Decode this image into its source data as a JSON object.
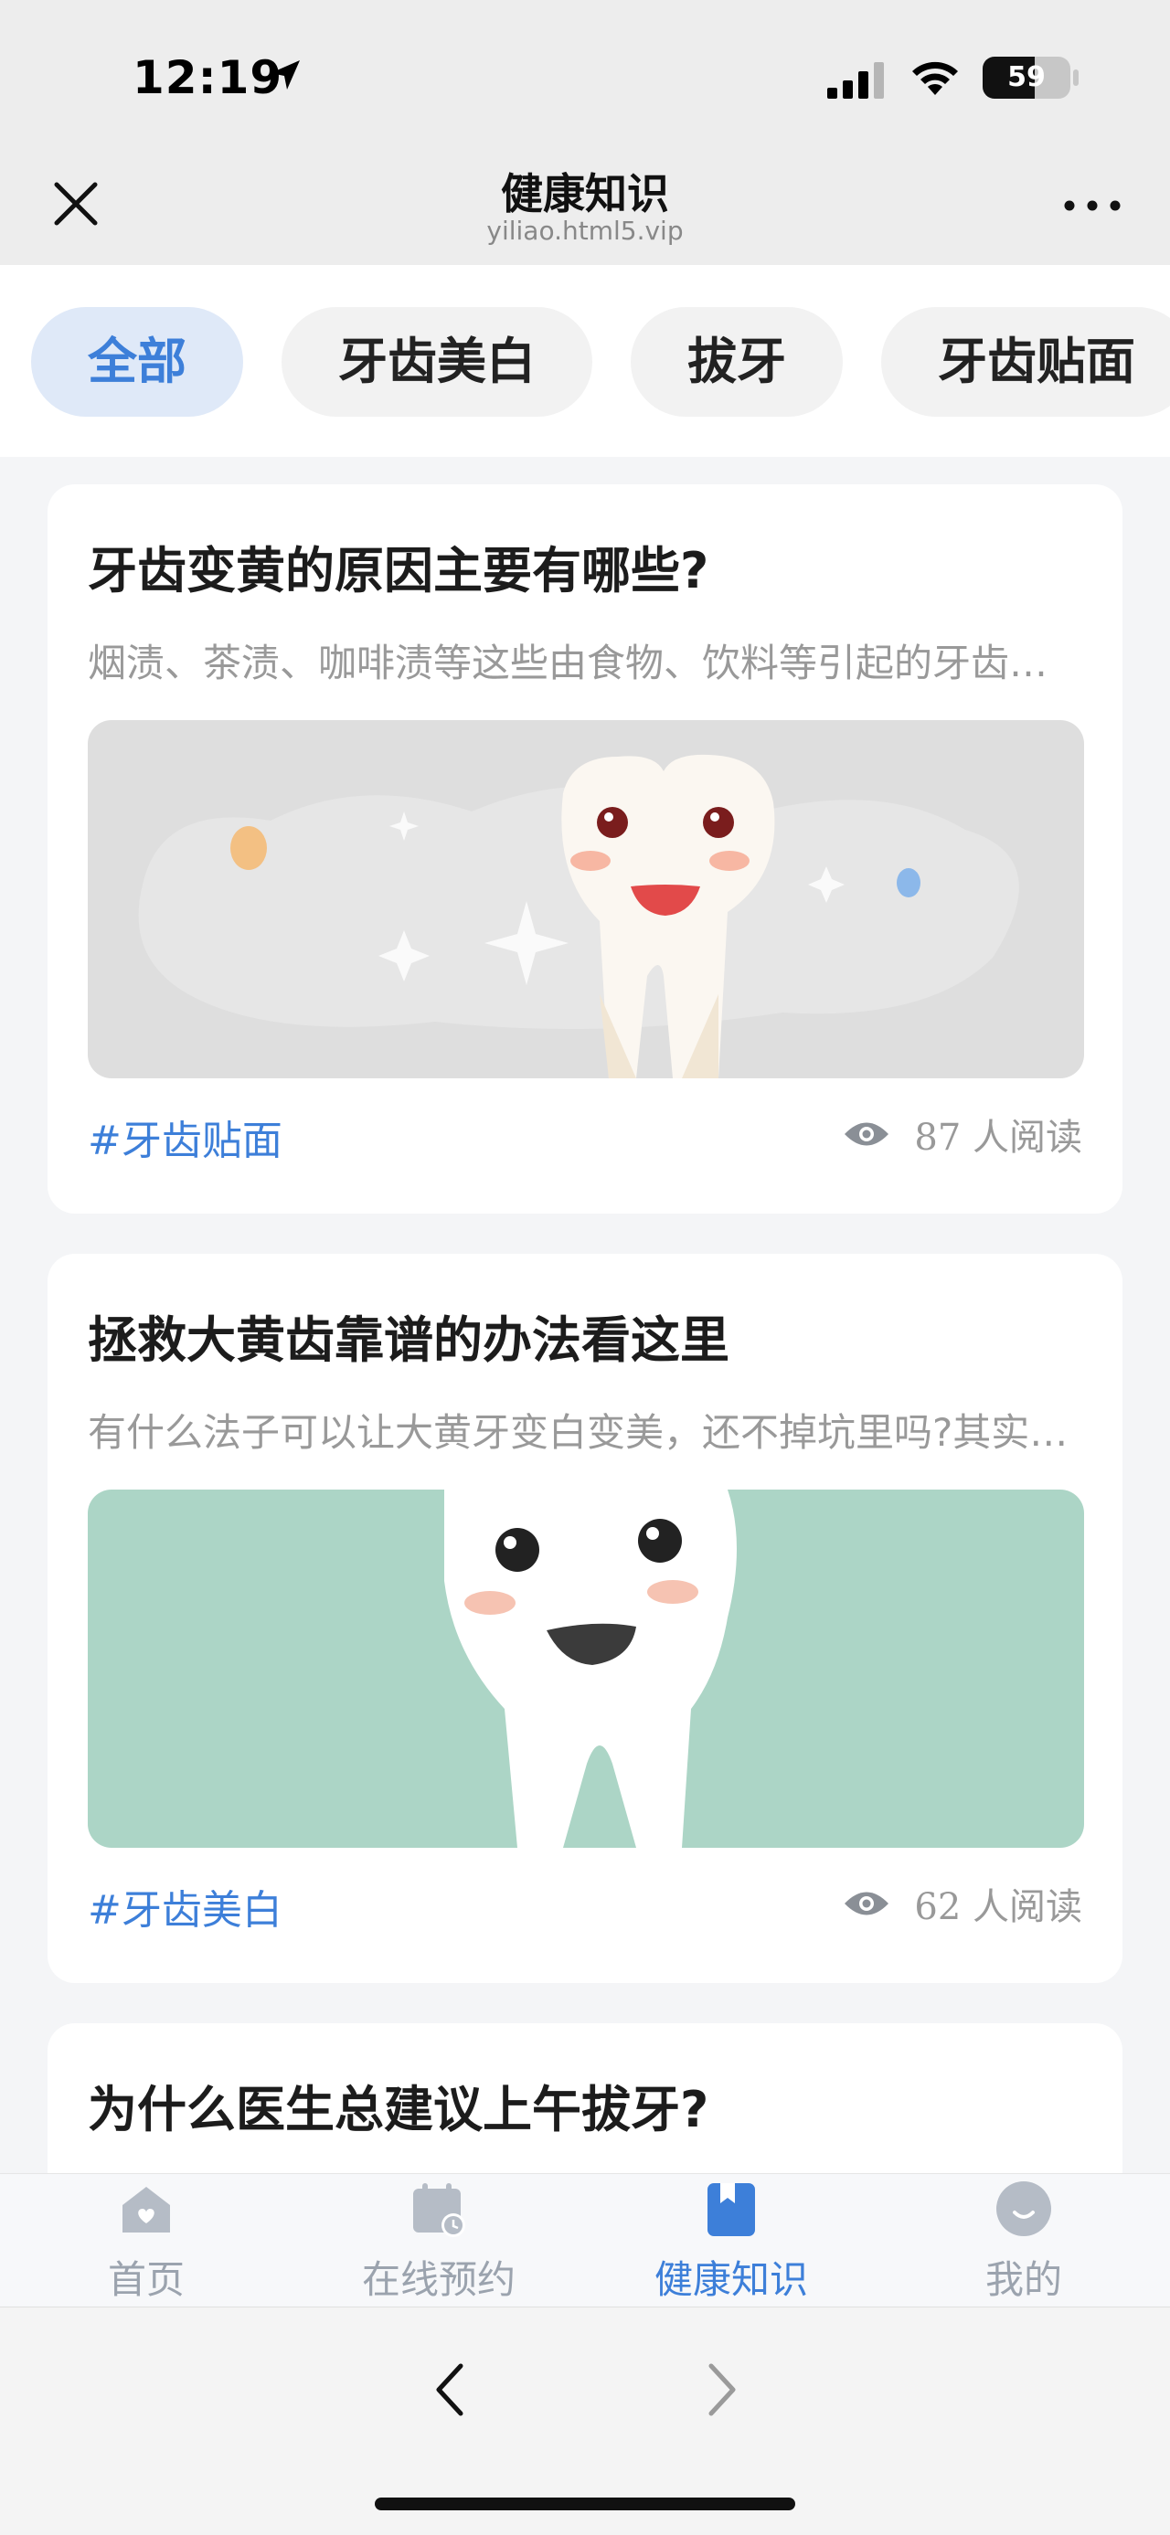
{
  "status_bar": {
    "time": "12:19",
    "battery": "59",
    "battery_level": 0.59
  },
  "header": {
    "title": "健康知识",
    "url": "yiliao.html5.vip"
  },
  "categories": [
    {
      "label": "全部",
      "active": true
    },
    {
      "label": "牙齿美白",
      "active": false
    },
    {
      "label": "拔牙",
      "active": false
    },
    {
      "label": "牙齿贴面",
      "active": false
    }
  ],
  "articles": [
    {
      "title": "牙齿变黄的原因主要有哪些?",
      "excerpt": "烟渍、茶渍、咖啡渍等这些由食物、饮料等引起的牙齿表面着色",
      "tag": "#牙齿贴面",
      "views": "87 人阅读",
      "image": {
        "bg": "#dedede",
        "icon": "tooth-illustration"
      }
    },
    {
      "title": "拯救大黄齿靠谱的办法看这里",
      "excerpt": "有什么法子可以让大黄牙变白变美，还不掉坑里吗?其实方法有很多",
      "tag": "#牙齿美白",
      "views": "62 人阅读",
      "image": {
        "bg": "#acd5c6",
        "icon": "tooth-illustration"
      }
    },
    {
      "title": "为什么医生总建议上午拔牙?"
    }
  ],
  "tabbar": [
    {
      "label": "首页",
      "icon": "home-icon",
      "active": false
    },
    {
      "label": "在线预约",
      "icon": "calendar-icon",
      "active": false
    },
    {
      "label": "健康知识",
      "icon": "book-icon",
      "active": true
    },
    {
      "label": "我的",
      "icon": "profile-icon",
      "active": false
    }
  ],
  "colors": {
    "accent": "#3d7fd9",
    "tab_active_bg": "#dfe9f8",
    "inactive": "#9ba3ae"
  }
}
